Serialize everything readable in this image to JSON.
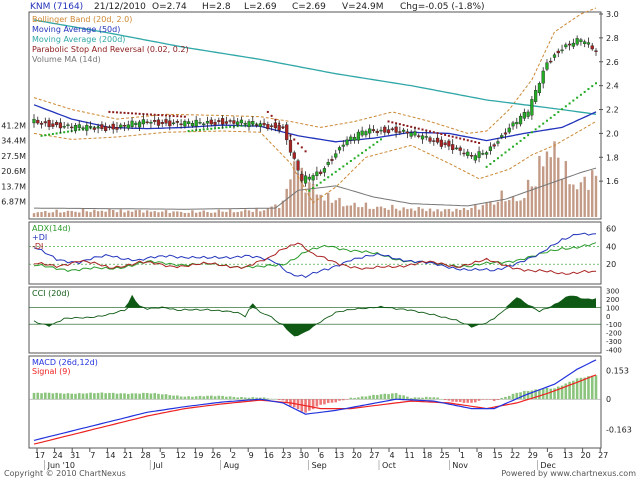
{
  "header": {
    "ticker": "KNM (7164)",
    "date": "21/12/2010",
    "open": "O=2.74",
    "high": "H=2.8",
    "low": "L=2.69",
    "close": "C=2.69",
    "volume": "V=24.9M",
    "change": "Chg=-0.05 (-1.8%)"
  },
  "footer": {
    "copyright": "Copyright © 2010 ChartNexus",
    "powered": "Powered by www.chartnexus.com"
  },
  "colors": {
    "bg": "#ffffff",
    "up_candle": "#22aa22",
    "down_candle": "#aa2222",
    "ma50": "#2233bb",
    "ma200": "#30a7a7",
    "bollinger": "#cc8833",
    "sar": "#8b1a1a",
    "volume": "#c39a86",
    "volume_ma": "#777777",
    "plus_di": "#2233bb",
    "minus_di": "#aa2222",
    "adx": "#2a9a2a",
    "cci_fill": "#0e5a14",
    "macd": "#2233dd",
    "signal": "#ee2222",
    "hist_pos": "#8bc47c",
    "hist_neg": "#ee7777"
  },
  "chart_data": [
    {
      "type": "candlestick",
      "panel": "price",
      "legend": [
        "Bollinger Band (20d, 2.0)",
        "Moving Average (50d)",
        "Moving Average (200d)",
        "Parabolic Stop And Reversal (0.02, 0.2)",
        "Volume MA (14d)"
      ],
      "ylim": [
        1.3,
        3.0
      ],
      "yticks": [
        "3.0",
        "2.8",
        "2.6",
        "2.4",
        "2.2",
        "2.0",
        "1.8",
        "1.6"
      ],
      "volume_ticks": [
        "41.2M",
        "34.4M",
        "27.5M",
        "20.6M",
        "13.7M",
        "6.87M"
      ],
      "volume_ylim": [
        0,
        48.1
      ],
      "bars": 150,
      "anchors": {
        "close": [
          [
            0,
            2.1
          ],
          [
            10,
            2.05
          ],
          [
            22,
            2.05
          ],
          [
            30,
            2.1
          ],
          [
            40,
            2.08
          ],
          [
            50,
            2.1
          ],
          [
            58,
            2.08
          ],
          [
            66,
            2.05
          ],
          [
            68,
            1.85
          ],
          [
            71,
            1.6
          ],
          [
            76,
            1.68
          ],
          [
            82,
            1.92
          ],
          [
            88,
            2.02
          ],
          [
            95,
            2.03
          ],
          [
            102,
            1.98
          ],
          [
            110,
            1.9
          ],
          [
            116,
            1.8
          ],
          [
            120,
            1.85
          ],
          [
            126,
            2.05
          ],
          [
            131,
            2.18
          ],
          [
            136,
            2.6
          ],
          [
            140,
            2.72
          ],
          [
            145,
            2.78
          ],
          [
            149,
            2.69
          ]
        ],
        "ma50": [
          [
            0,
            2.24
          ],
          [
            10,
            2.12
          ],
          [
            20,
            2.05
          ],
          [
            30,
            2.04
          ],
          [
            40,
            2.05
          ],
          [
            50,
            2.07
          ],
          [
            60,
            2.06
          ],
          [
            70,
            1.98
          ],
          [
            80,
            1.93
          ],
          [
            90,
            1.96
          ],
          [
            100,
            2.01
          ],
          [
            110,
            2.0
          ],
          [
            120,
            1.94
          ],
          [
            130,
            2.0
          ],
          [
            140,
            2.05
          ],
          [
            149,
            2.18
          ]
        ],
        "ma200": [
          [
            0,
            2.95
          ],
          [
            20,
            2.84
          ],
          [
            40,
            2.72
          ],
          [
            60,
            2.62
          ],
          [
            80,
            2.5
          ],
          [
            100,
            2.4
          ],
          [
            120,
            2.28
          ],
          [
            140,
            2.2
          ],
          [
            149,
            2.16
          ]
        ],
        "bb_upper": [
          [
            0,
            2.3
          ],
          [
            10,
            2.2
          ],
          [
            22,
            2.12
          ],
          [
            35,
            2.16
          ],
          [
            50,
            2.15
          ],
          [
            60,
            2.14
          ],
          [
            68,
            2.1
          ],
          [
            76,
            2.05
          ],
          [
            85,
            2.1
          ],
          [
            95,
            2.18
          ],
          [
            105,
            2.1
          ],
          [
            115,
            2.0
          ],
          [
            120,
            2.02
          ],
          [
            126,
            2.2
          ],
          [
            132,
            2.45
          ],
          [
            138,
            2.85
          ],
          [
            145,
            3.0
          ],
          [
            149,
            3.05
          ]
        ],
        "bb_lower": [
          [
            0,
            2.0
          ],
          [
            10,
            1.95
          ],
          [
            22,
            1.97
          ],
          [
            35,
            2.01
          ],
          [
            50,
            2.02
          ],
          [
            60,
            2.01
          ],
          [
            68,
            1.75
          ],
          [
            74,
            1.42
          ],
          [
            80,
            1.55
          ],
          [
            88,
            1.8
          ],
          [
            100,
            1.9
          ],
          [
            110,
            1.75
          ],
          [
            118,
            1.62
          ],
          [
            126,
            1.7
          ],
          [
            132,
            1.82
          ],
          [
            138,
            1.9
          ],
          [
            149,
            2.1
          ]
        ],
        "volume": [
          [
            0,
            3
          ],
          [
            20,
            4
          ],
          [
            40,
            3
          ],
          [
            60,
            4
          ],
          [
            66,
            8
          ],
          [
            69,
            34
          ],
          [
            72,
            20
          ],
          [
            76,
            14
          ],
          [
            82,
            8
          ],
          [
            90,
            6
          ],
          [
            100,
            5
          ],
          [
            110,
            4
          ],
          [
            118,
            6
          ],
          [
            124,
            12
          ],
          [
            128,
            10
          ],
          [
            133,
            22
          ],
          [
            136,
            45
          ],
          [
            140,
            30
          ],
          [
            144,
            18
          ],
          [
            149,
            24.9
          ]
        ],
        "volume_ma": [
          [
            0,
            4
          ],
          [
            40,
            3.5
          ],
          [
            64,
            4
          ],
          [
            70,
            12
          ],
          [
            80,
            14
          ],
          [
            90,
            9
          ],
          [
            100,
            6
          ],
          [
            115,
            5
          ],
          [
            125,
            8
          ],
          [
            135,
            14
          ],
          [
            145,
            20
          ],
          [
            149,
            22
          ]
        ]
      },
      "sar_segments": [
        {
          "trend": "up",
          "from": 2,
          "to": 18,
          "start": 1.98,
          "end": 2.06
        },
        {
          "trend": "down",
          "from": 20,
          "to": 40,
          "start": 2.18,
          "end": 2.14
        },
        {
          "trend": "up",
          "from": 41,
          "to": 60,
          "start": 2.02,
          "end": 2.08
        },
        {
          "trend": "down",
          "from": 62,
          "to": 72,
          "start": 2.18,
          "end": 1.85
        },
        {
          "trend": "up",
          "from": 73,
          "to": 92,
          "start": 1.52,
          "end": 1.95
        },
        {
          "trend": "down",
          "from": 94,
          "to": 118,
          "start": 2.1,
          "end": 1.92
        },
        {
          "trend": "up",
          "from": 120,
          "to": 149,
          "start": 1.72,
          "end": 2.42
        }
      ]
    },
    {
      "type": "line",
      "panel": "adx",
      "series_labels": [
        "ADX(14d)",
        "+DI",
        "-DI"
      ],
      "yticks": [
        "60",
        "40",
        "20"
      ],
      "ylim": [
        0,
        65
      ],
      "series": [
        {
          "name": "ADX(14d)",
          "color": "#2a9a2a",
          "anchors": [
            [
              0,
              18
            ],
            [
              10,
              14
            ],
            [
              20,
              15
            ],
            [
              30,
              22
            ],
            [
              40,
              20
            ],
            [
              50,
              19
            ],
            [
              60,
              16
            ],
            [
              66,
              20
            ],
            [
              72,
              34
            ],
            [
              78,
              40
            ],
            [
              86,
              35
            ],
            [
              96,
              26
            ],
            [
              106,
              20
            ],
            [
              116,
              18
            ],
            [
              124,
              22
            ],
            [
              134,
              30
            ],
            [
              140,
              38
            ],
            [
              149,
              42
            ]
          ]
        },
        {
          "name": "+DI",
          "color": "#2233bb",
          "anchors": [
            [
              0,
              38
            ],
            [
              6,
              26
            ],
            [
              12,
              22
            ],
            [
              20,
              30
            ],
            [
              28,
              24
            ],
            [
              36,
              30
            ],
            [
              46,
              26
            ],
            [
              56,
              30
            ],
            [
              64,
              22
            ],
            [
              68,
              10
            ],
            [
              72,
              6
            ],
            [
              78,
              14
            ],
            [
              84,
              26
            ],
            [
              92,
              30
            ],
            [
              100,
              24
            ],
            [
              108,
              18
            ],
            [
              116,
              14
            ],
            [
              122,
              12
            ],
            [
              128,
              22
            ],
            [
              134,
              30
            ],
            [
              140,
              48
            ],
            [
              144,
              55
            ],
            [
              149,
              52
            ]
          ]
        },
        {
          "name": "-DI",
          "color": "#aa2222",
          "anchors": [
            [
              0,
              20
            ],
            [
              6,
              18
            ],
            [
              12,
              24
            ],
            [
              20,
              16
            ],
            [
              28,
              22
            ],
            [
              36,
              18
            ],
            [
              46,
              20
            ],
            [
              56,
              17
            ],
            [
              62,
              25
            ],
            [
              66,
              38
            ],
            [
              70,
              45
            ],
            [
              74,
              30
            ],
            [
              80,
              22
            ],
            [
              88,
              14
            ],
            [
              96,
              18
            ],
            [
              104,
              22
            ],
            [
              112,
              18
            ],
            [
              120,
              24
            ],
            [
              126,
              18
            ],
            [
              132,
              12
            ],
            [
              140,
              10
            ],
            [
              146,
              12
            ],
            [
              149,
              10
            ]
          ]
        }
      ]
    },
    {
      "type": "area",
      "panel": "cci",
      "series_labels": [
        "CCI (20d)"
      ],
      "yticks": [
        "300",
        "200",
        "100",
        "0",
        "-100",
        "-200",
        "-300",
        "-400"
      ],
      "ylim": [
        -420,
        320
      ],
      "anchors": [
        [
          0,
          -60
        ],
        [
          4,
          -120
        ],
        [
          8,
          -40
        ],
        [
          14,
          -20
        ],
        [
          20,
          20
        ],
        [
          24,
          60
        ],
        [
          26,
          240
        ],
        [
          28,
          120
        ],
        [
          30,
          90
        ],
        [
          34,
          110
        ],
        [
          38,
          60
        ],
        [
          42,
          70
        ],
        [
          46,
          80
        ],
        [
          50,
          60
        ],
        [
          54,
          30
        ],
        [
          56,
          -10
        ],
        [
          58,
          150
        ],
        [
          60,
          40
        ],
        [
          62,
          20
        ],
        [
          66,
          -120
        ],
        [
          69,
          -260
        ],
        [
          72,
          -200
        ],
        [
          76,
          -60
        ],
        [
          80,
          40
        ],
        [
          86,
          80
        ],
        [
          92,
          120
        ],
        [
          96,
          80
        ],
        [
          100,
          60
        ],
        [
          106,
          20
        ],
        [
          112,
          -60
        ],
        [
          116,
          -140
        ],
        [
          120,
          -80
        ],
        [
          124,
          40
        ],
        [
          128,
          220
        ],
        [
          130,
          160
        ],
        [
          134,
          60
        ],
        [
          138,
          140
        ],
        [
          142,
          240
        ],
        [
          146,
          200
        ],
        [
          149,
          210
        ]
      ]
    },
    {
      "type": "line",
      "panel": "macd",
      "series_labels": [
        "MACD (26d,12d)",
        "Signal (9)"
      ],
      "yticks": [
        "0.153",
        "0",
        "-0.163"
      ],
      "ylim": [
        -0.25,
        0.22
      ],
      "series": [
        {
          "name": "MACD (26d,12d)",
          "color": "#2233dd",
          "anchors": [
            [
              0,
              -0.22
            ],
            [
              10,
              -0.17
            ],
            [
              20,
              -0.12
            ],
            [
              30,
              -0.07
            ],
            [
              40,
              -0.04
            ],
            [
              50,
              -0.015
            ],
            [
              60,
              0.0
            ],
            [
              66,
              -0.02
            ],
            [
              72,
              -0.08
            ],
            [
              80,
              -0.06
            ],
            [
              88,
              -0.03
            ],
            [
              96,
              0.0
            ],
            [
              106,
              -0.01
            ],
            [
              116,
              -0.05
            ],
            [
              122,
              -0.05
            ],
            [
              130,
              0.02
            ],
            [
              138,
              0.08
            ],
            [
              144,
              0.16
            ],
            [
              149,
              0.21
            ]
          ]
        },
        {
          "name": "Signal (9)",
          "color": "#ee2222",
          "anchors": [
            [
              0,
              -0.24
            ],
            [
              10,
              -0.19
            ],
            [
              20,
              -0.14
            ],
            [
              30,
              -0.09
            ],
            [
              40,
              -0.05
            ],
            [
              50,
              -0.025
            ],
            [
              60,
              -0.005
            ],
            [
              68,
              -0.02
            ],
            [
              76,
              -0.05
            ],
            [
              84,
              -0.05
            ],
            [
              92,
              -0.03
            ],
            [
              100,
              -0.01
            ],
            [
              110,
              -0.02
            ],
            [
              120,
              -0.05
            ],
            [
              128,
              -0.02
            ],
            [
              136,
              0.03
            ],
            [
              144,
              0.09
            ],
            [
              149,
              0.13
            ]
          ]
        }
      ]
    }
  ],
  "x_axis": {
    "day_labels": [
      "17",
      "24",
      "31",
      "7",
      "14",
      "21",
      "28",
      "5",
      "12",
      "19",
      "26",
      "2",
      "9",
      "16",
      "23",
      "30",
      "6",
      "13",
      "20",
      "27",
      "4",
      "11",
      "18",
      "25",
      "1",
      "8",
      "15",
      "22",
      "29",
      "6",
      "13",
      "20",
      "27"
    ],
    "month_labels": [
      "Jun '10",
      "Jul",
      "Aug",
      "Sep",
      "Oct",
      "Nov",
      "Dec"
    ]
  }
}
